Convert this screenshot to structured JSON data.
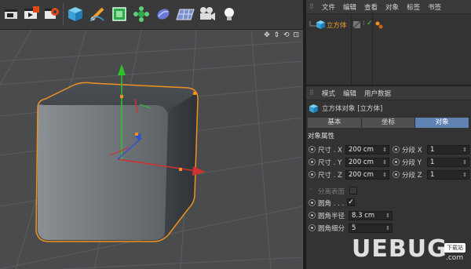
{
  "toolbar": {
    "icons": [
      "render-view-icon",
      "render-icon",
      "render-settings-icon",
      "cube-icon",
      "pen-icon",
      "subdivision-icon",
      "cloner-icon",
      "deformer-icon",
      "floor-icon",
      "camera-icon",
      "light-icon"
    ]
  },
  "viewport": {
    "nav_icons": "✥ ⇕ ⟲ ⊡"
  },
  "object_manager": {
    "menu": [
      "文件",
      "编辑",
      "查看",
      "对象",
      "标签",
      "书签"
    ],
    "object_name": "立方体"
  },
  "attribute_manager": {
    "menu": [
      "模式",
      "编辑",
      "用户数据"
    ],
    "header": "立方体对象 [立方体]",
    "tabs": [
      "基本",
      "坐标",
      "对象"
    ],
    "active_tab": "对象",
    "section": "对象属性",
    "size_x_label": "尺寸 . X",
    "size_y_label": "尺寸 . Y",
    "size_z_label": "尺寸 . Z",
    "size_x": "200 cm",
    "size_y": "200 cm",
    "size_z": "200 cm",
    "seg_x_label": "分段 X",
    "seg_y_label": "分段 Y",
    "seg_z_label": "分段 Z",
    "seg_x": "1",
    "seg_y": "1",
    "seg_z": "1",
    "separate_label": "分离表面",
    "fillet_label": "圆角 . . . .",
    "fillet_checked": "✓",
    "fillet_radius_label": "圆角半径",
    "fillet_radius": "8.3 cm",
    "fillet_sub_label": "圆角细分",
    "fillet_sub": "5"
  },
  "watermark": {
    "brand": "UEBUG",
    "tag": "下载站",
    "domain": ".com"
  },
  "colors": {
    "accent": "#5f82b3",
    "selection": "#f0a030",
    "axis_x": "#d23030",
    "axis_y": "#2fc22f",
    "axis_z": "#3050d0"
  }
}
